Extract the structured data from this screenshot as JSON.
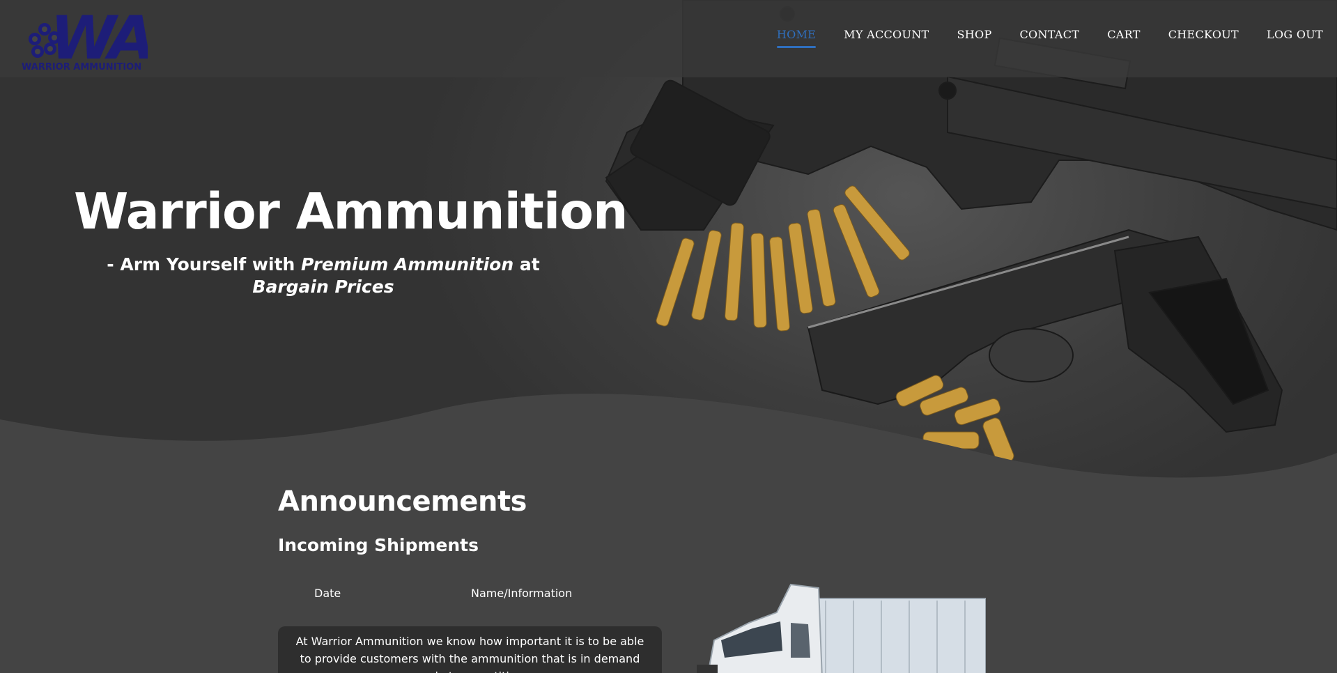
{
  "brand": {
    "logo_monogram": "WA",
    "logo_text": "WARRIOR AMMUNITION",
    "logo_color": "#1d1d78"
  },
  "nav": {
    "items": [
      {
        "label": "HOME",
        "active": true
      },
      {
        "label": "MY ACCOUNT",
        "active": false
      },
      {
        "label": "SHOP",
        "active": false
      },
      {
        "label": "CONTACT",
        "active": false
      },
      {
        "label": "CART",
        "active": false
      },
      {
        "label": "CHECKOUT",
        "active": false
      },
      {
        "label": "LOG OUT",
        "active": false
      }
    ],
    "active_color": "#2f6fbe"
  },
  "hero": {
    "title": "Warrior Ammunition",
    "tagline_prefix": "- Arm Yourself with ",
    "tagline_em1": "Premium Ammunition",
    "tagline_mid": " at ",
    "tagline_em2": "Bargain Prices"
  },
  "announcements": {
    "title": "Announcements",
    "subtitle": "Incoming Shipments",
    "columns": [
      "Date",
      "Name/Information"
    ],
    "body": "At Warrior Ammunition we know how important it is to be able to provide customers with the ammunition that is in demand and at competitive"
  },
  "colors": {
    "page_bg": "#444444",
    "info_box_bg": "#2e2e2e"
  }
}
